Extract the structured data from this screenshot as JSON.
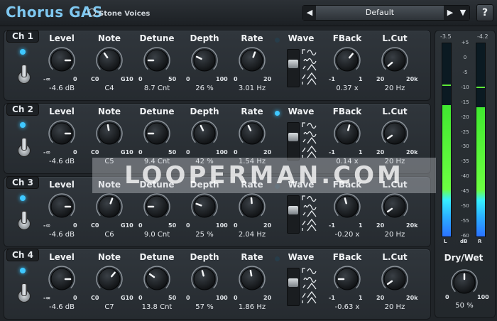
{
  "header": {
    "title": "Chorus GAS",
    "vendor": "Stone Voices",
    "preset_name": "Default",
    "prev_icon": "◀",
    "next_icon": "▶",
    "dropdown_icon": "▼",
    "help_label": "?"
  },
  "labels": {
    "level": "Level",
    "note": "Note",
    "detune": "Detune",
    "depth": "Depth",
    "rate": "Rate",
    "wave": "Wave",
    "fback": "FBack",
    "lcut": "L.Cut"
  },
  "scales": {
    "level_min": "-∞",
    "level_max": "0",
    "note_min": "C0",
    "note_max": "G10",
    "detune_min": "0",
    "detune_max": "50",
    "depth_min": "0",
    "depth_max": "100",
    "rate_min": "0",
    "rate_max": "20",
    "fback_min": "-1",
    "fback_max": "1",
    "lcut_min": "20",
    "lcut_max": "20k"
  },
  "channels": [
    {
      "name": "Ch 1",
      "level": "-4.6 dB",
      "note": "C4",
      "detune": "8.7 Cnt",
      "depth": "26 %",
      "rate": "3.01 Hz",
      "fback": "0.37 x",
      "lcut": "20 Hz",
      "rate_led": false
    },
    {
      "name": "Ch 2",
      "level": "-4.6 dB",
      "note": "C5",
      "detune": "9.4 Cnt",
      "depth": "42 %",
      "rate": "1.54 Hz",
      "fback": "0.14 x",
      "lcut": "20 Hz",
      "rate_led": true
    },
    {
      "name": "Ch 3",
      "level": "-4.6 dB",
      "note": "C6",
      "detune": "9.0 Cnt",
      "depth": "25 %",
      "rate": "2.04 Hz",
      "fback": "-0.20 x",
      "lcut": "20 Hz",
      "rate_led": false
    },
    {
      "name": "Ch 4",
      "level": "-4.6 dB",
      "note": "C7",
      "detune": "13.8 Cnt",
      "depth": "57 %",
      "rate": "1.86 Hz",
      "fback": "-0.63 x",
      "lcut": "20 Hz",
      "rate_led": false
    }
  ],
  "meters": {
    "peak_left": "-3.5",
    "peak_right": "-4.2",
    "left_label": "L",
    "db_label": "dB",
    "right_label": "R",
    "ticks": [
      "+5",
      "0",
      "-5",
      "-10",
      "-15",
      "-20",
      "-25",
      "-30",
      "-35",
      "-40",
      "-45",
      "-50",
      "-55",
      "-60"
    ],
    "left_level": 0.68,
    "right_level": 0.67
  },
  "drywet": {
    "label": "Dry/Wet",
    "min": "0",
    "max": "100",
    "value": "50 %"
  },
  "watermark": "LOOPERMAN.COM",
  "colors": {
    "accent": "#7fc8f0",
    "led": "#3fc8ff",
    "meter_green": "#40e830",
    "meter_blue": "#2b72ff"
  }
}
